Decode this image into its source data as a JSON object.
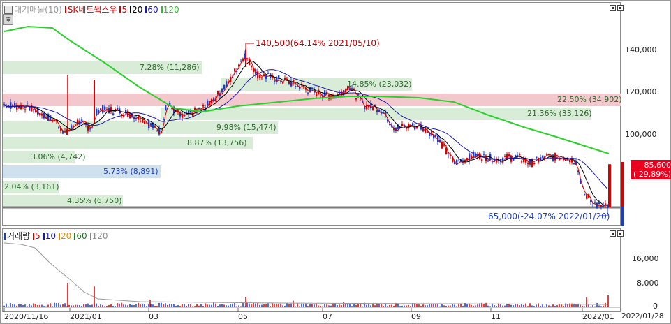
{
  "price_pane": {
    "legend": {
      "prefix_label": "대기매물(10)",
      "stock_name": "SK네트웍스우",
      "ma_items": [
        {
          "label": "5",
          "color": "#d40000"
        },
        {
          "label": "20",
          "color": "#000000"
        },
        {
          "label": "60",
          "color": "#1a1ab0"
        },
        {
          "label": "120",
          "color": "#2bbd2b"
        }
      ]
    },
    "y_axis_labels": [
      "140,000",
      "120,000",
      "100,000"
    ],
    "max_annotation": "140,500(64.14% 2021/05/10)",
    "min_annotation": "65,000(-24.07% 2022/01/20)",
    "current_price": "85,600",
    "current_change": "( 29.89%)",
    "volume_profile": [
      {
        "text": "7.28% (11,286)",
        "color": "#d8ecd8"
      },
      {
        "text": "14.85% (23,032)",
        "color": "#d8ecd8"
      },
      {
        "text": "22.50% (34,902)",
        "color": "#f3c8cc"
      },
      {
        "text": "21.36% (33,126)",
        "color": "#d8ecd8"
      },
      {
        "text": "9.98% (15,474)",
        "color": "#d8ecd8"
      },
      {
        "text": "8.87% (13,756)",
        "color": "#d8ecd8"
      },
      {
        "text": "3.06% (4,742)",
        "color": "#d8ecd8"
      },
      {
        "text": "5.73% (8,891)",
        "color": "#cfe1ef"
      },
      {
        "text": "2.04% (3,161)",
        "color": "#d8ecd8"
      },
      {
        "text": "4.35% (6,750)",
        "color": "#d8ecd8"
      }
    ]
  },
  "volume_pane": {
    "legend": {
      "title": "거래량",
      "ma_items": [
        {
          "label": "5",
          "color": "#d40000"
        },
        {
          "label": "10",
          "color": "#1a1ab0"
        },
        {
          "label": "20",
          "color": "#e08a00"
        },
        {
          "label": "60",
          "color": "#1f7a1f"
        },
        {
          "label": "120",
          "color": "#8a8a8a"
        }
      ]
    },
    "y_axis_labels": [
      "16,000",
      "8,000",
      "0"
    ]
  },
  "x_axis_labels": [
    "2020/11/16",
    "2021/01",
    "03",
    "05",
    "07",
    "09",
    "11",
    "2022/01",
    "2022/01/28"
  ],
  "colors": {
    "up": "#d40000",
    "down": "#1a3cc8",
    "ma5": "#d40000",
    "ma20": "#000000",
    "ma60": "#1a1ab0",
    "ma120": "#2bd12b"
  }
}
